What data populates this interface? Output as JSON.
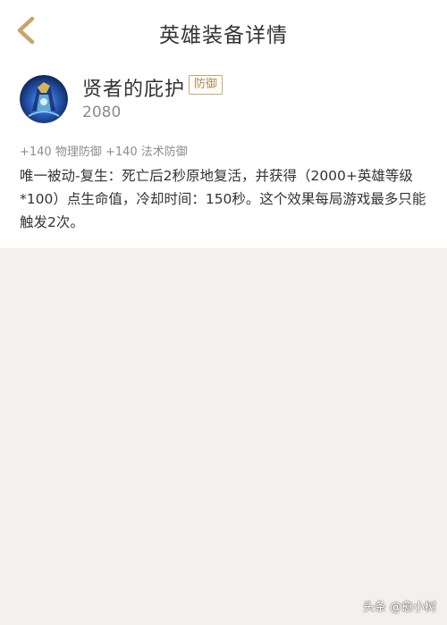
{
  "header": {
    "title": "英雄装备详情",
    "back_icon": "chevron-left-icon"
  },
  "item": {
    "name": "贤者的庇护",
    "tag": "防御",
    "price": "2080",
    "stats": "+140 物理防御 +140 法术防御",
    "description": "唯一被动-复生：死亡后2秒原地复活，并获得（2000+英雄等级*100）点生命值，冷却时间：150秒。这个效果每局游戏最多只能触发2次。"
  },
  "watermark": "头条 @愈小树",
  "colors": {
    "accent": "#c9a46a",
    "tag_border": "#c7a870",
    "background": "#f3f0ed",
    "card": "#ffffff"
  }
}
